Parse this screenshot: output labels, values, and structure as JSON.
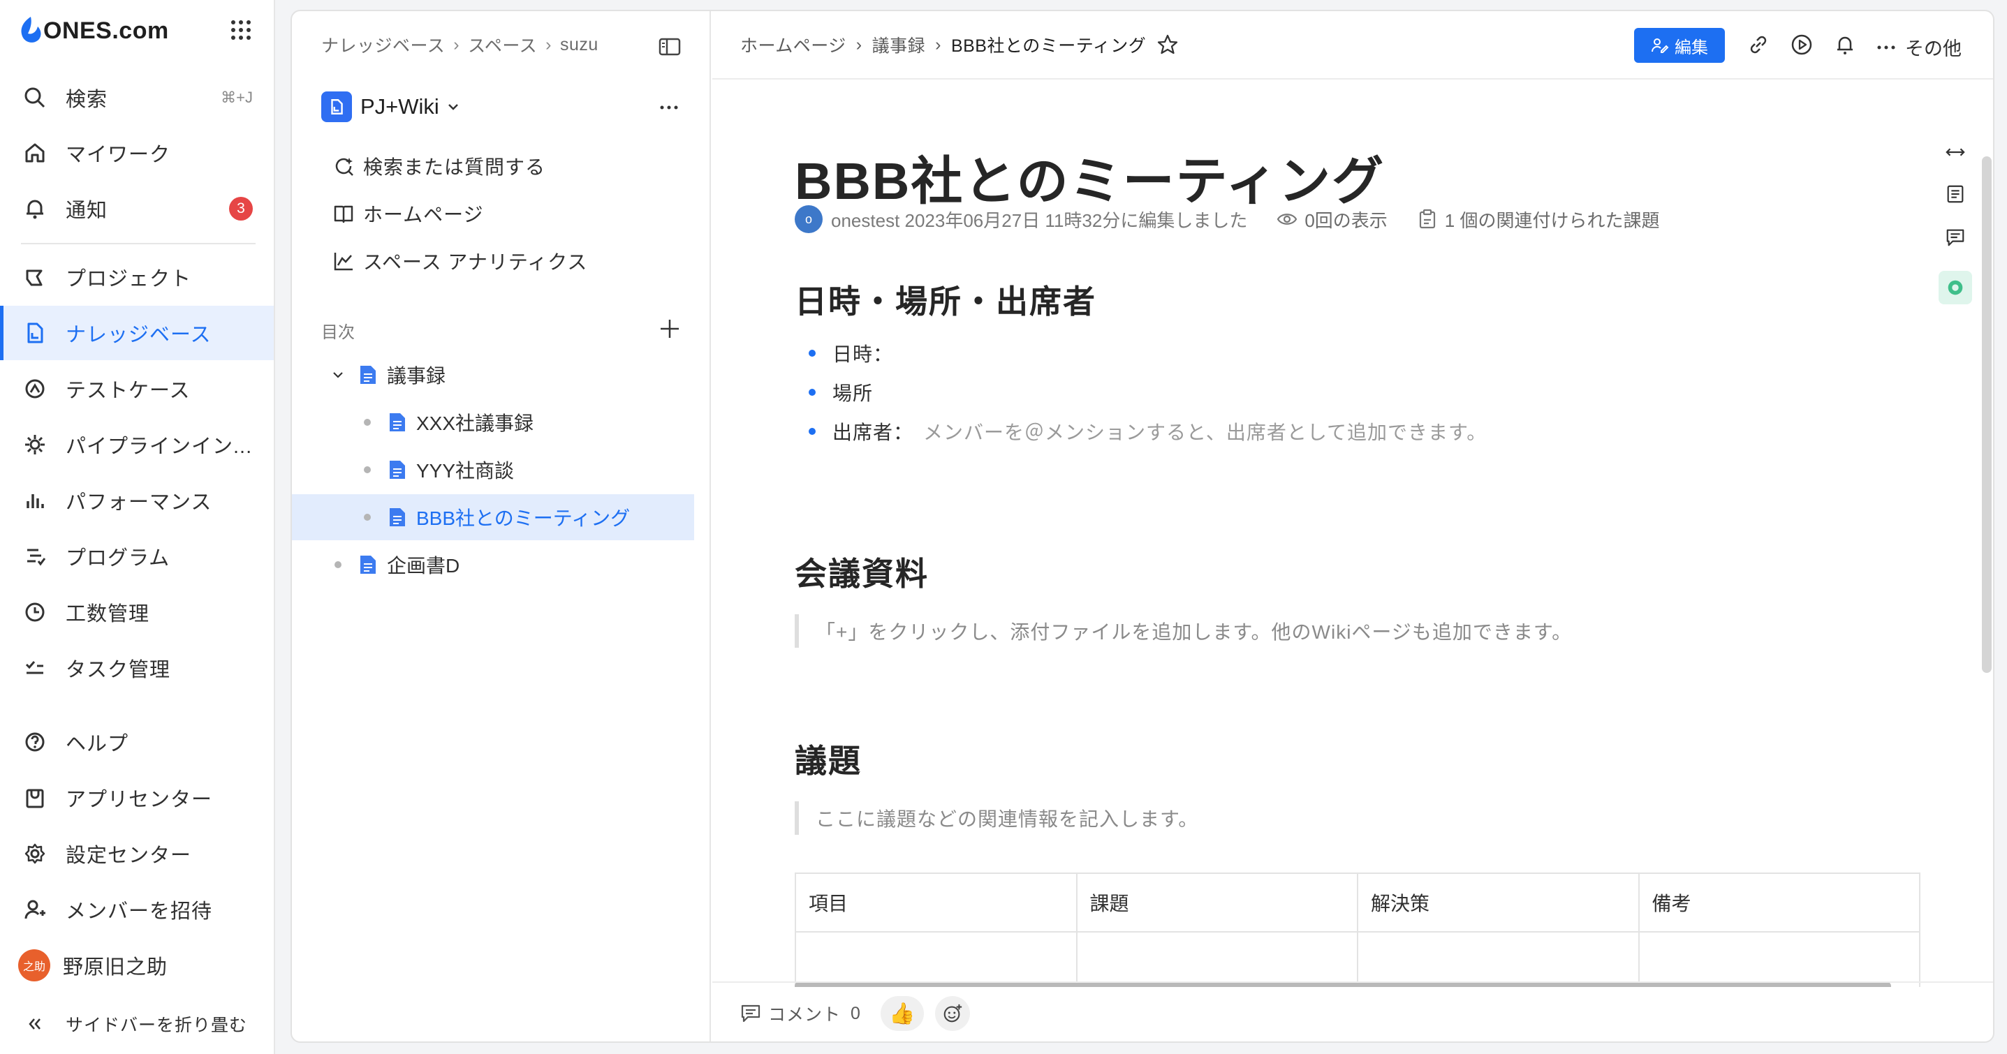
{
  "brand": {
    "name": "ONES.com",
    "color": "#1d6ff2"
  },
  "nav": {
    "search": {
      "label": "検索",
      "shortcut": "⌘+J"
    },
    "items": [
      {
        "label": "マイワーク",
        "icon": "home-icon"
      },
      {
        "label": "通知",
        "icon": "bell-icon",
        "badge": "3"
      },
      {
        "label": "プロジェクト",
        "icon": "project-icon"
      },
      {
        "label": "ナレッジベース",
        "icon": "knowledge-base-icon",
        "active": true
      },
      {
        "label": "テストケース",
        "icon": "testcase-icon"
      },
      {
        "label": "パイプラインイン...",
        "icon": "pipeline-icon"
      },
      {
        "label": "パフォーマンス",
        "icon": "performance-icon"
      },
      {
        "label": "プログラム",
        "icon": "program-icon"
      },
      {
        "label": "工数管理",
        "icon": "clock-icon"
      },
      {
        "label": "タスク管理",
        "icon": "task-icon"
      },
      {
        "label": "ヘルプ",
        "icon": "help-icon"
      },
      {
        "label": "アプリセンター",
        "icon": "app-center-icon"
      },
      {
        "label": "設定センター",
        "icon": "gear-icon"
      },
      {
        "label": "メンバーを招待",
        "icon": "invite-member-icon"
      }
    ],
    "user": {
      "name": "野原旧之助",
      "avatar_text": "之助"
    },
    "collapse": "サイドバーを折り畳む"
  },
  "wiki_sidebar": {
    "breadcrumb": [
      "ナレッジベース",
      "スペース",
      "suzu"
    ],
    "space_name": "PJ+Wiki",
    "actions": [
      "検索または質問する",
      "ホームページ",
      "スペース アナリティクス"
    ],
    "toc_label": "目次",
    "toc": [
      {
        "label": "議事録",
        "level": 0,
        "expanded": true
      },
      {
        "label": "XXX社議事録",
        "level": 1
      },
      {
        "label": "YYY社商談",
        "level": 1
      },
      {
        "label": "BBB社とのミーティング",
        "level": 1,
        "active": true
      },
      {
        "label": "企画書D",
        "level": 0
      }
    ]
  },
  "content": {
    "breadcrumb": [
      "ホームページ",
      "議事録",
      "BBB社とのミーティング"
    ],
    "edit_label": "編集",
    "more_label": "その他",
    "title": "BBB社とのミーティング",
    "meta": {
      "avatar": "o",
      "edited": "onestest 2023年06月27日 11時32分に編集しました",
      "views": "0回の表示",
      "linked": "1 個の関連付けられた課題"
    },
    "section1": {
      "heading": "日時・場所・出席者",
      "bullets": [
        {
          "label": "日時：",
          "placeholder": ""
        },
        {
          "label": "場所",
          "placeholder": ""
        },
        {
          "label": "出席者：",
          "placeholder": "メンバーを＠メンションすると、出席者として追加できます。"
        }
      ]
    },
    "section2": {
      "heading": "会議資料",
      "quote": "「+」をクリックし、添付ファイルを追加します。他のWikiページも追加できます。"
    },
    "section3": {
      "heading": "議題",
      "quote": "ここに議題などの関連情報を記入します。",
      "table_headers": [
        "項目",
        "課題",
        "解決策",
        "備考"
      ]
    },
    "footer": {
      "comment_label": "コメント",
      "comment_count": "0",
      "like_emoji": "👍"
    }
  }
}
